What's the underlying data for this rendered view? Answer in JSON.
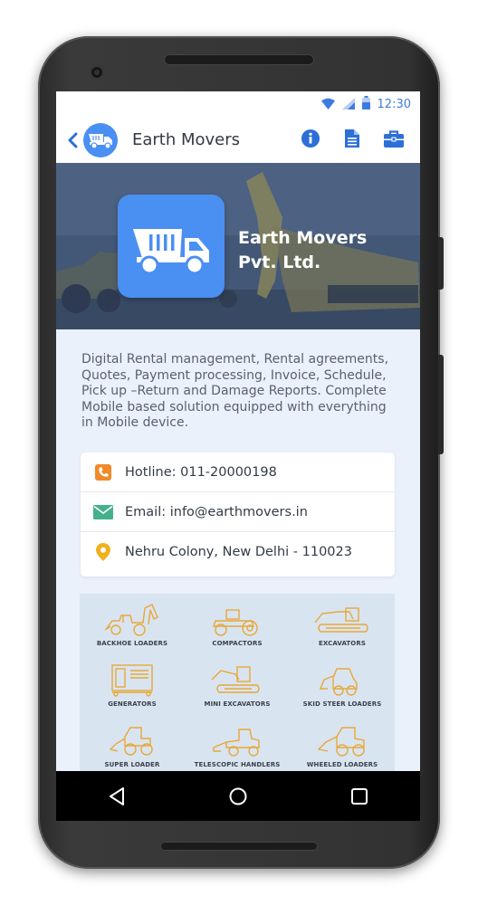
{
  "status": {
    "time": "12:30",
    "icons": [
      "wifi-icon",
      "signal-icon",
      "battery-icon"
    ]
  },
  "appbar": {
    "title": "Earth Movers",
    "back_icon": "chevron-left-icon",
    "actions": [
      "info-icon",
      "document-icon",
      "briefcase-icon"
    ]
  },
  "hero": {
    "name_line1": "Earth Movers",
    "name_line2": "Pvt. Ltd."
  },
  "description": "Digital Rental management, Rental agreements, Quotes, Payment processing, Invoice, Schedule, Pick up –Return and Damage Reports. Complete Mobile based solution equipped with everything in Mobile device.",
  "contacts": [
    {
      "icon": "phone-icon",
      "text": "Hotline: 011-20000198",
      "color": "#f08a2b"
    },
    {
      "icon": "email-icon",
      "text": "Email: info@earthmovers.in",
      "color": "#45b08c"
    },
    {
      "icon": "location-icon",
      "text": "Nehru Colony, New Delhi - 110023",
      "color": "#f2b01e"
    }
  ],
  "equipment": [
    {
      "label": "Backhoe Loaders"
    },
    {
      "label": "Compactors"
    },
    {
      "label": "Excavators"
    },
    {
      "label": "Generators"
    },
    {
      "label": "Mini Excavators"
    },
    {
      "label": "Skid Steer Loaders"
    },
    {
      "label": "Super Loader"
    },
    {
      "label": "Telescopic Handlers"
    },
    {
      "label": "Wheeled Loaders"
    }
  ],
  "navbar": [
    "back-triangle-icon",
    "home-circle-icon",
    "recents-square-icon"
  ],
  "colors": {
    "accent": "#4a8ff2",
    "equipment_stroke": "#e8a838",
    "background": "#eaf1fb"
  }
}
